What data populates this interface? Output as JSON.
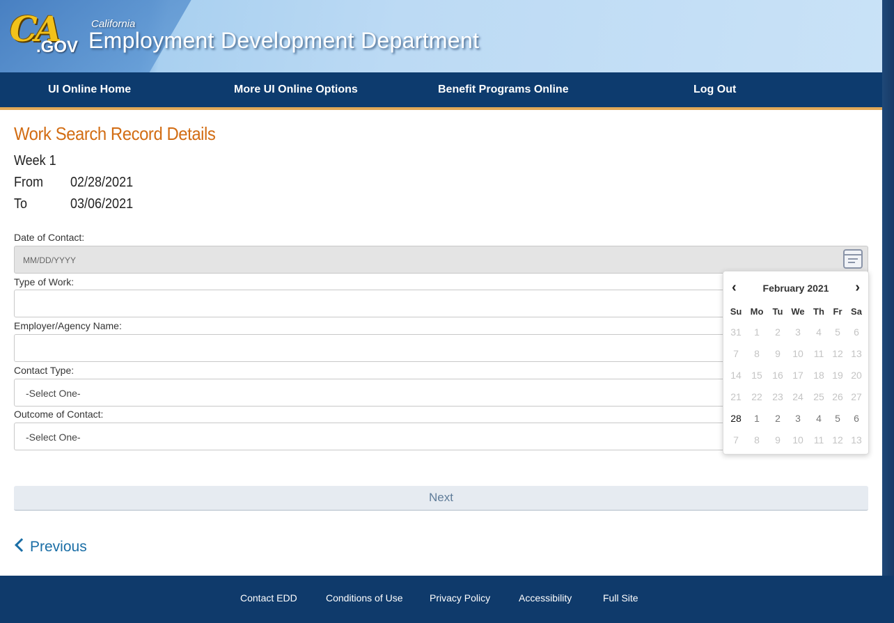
{
  "header": {
    "logo_ca": "CA",
    "logo_gov": ".GOV",
    "state": "California",
    "department": "Employment Development Department"
  },
  "nav": {
    "items": [
      "UI Online Home",
      "More UI Online Options",
      "Benefit Programs Online",
      "Log Out"
    ]
  },
  "page": {
    "title": "Work Search Record Details",
    "week": "Week 1",
    "from_label": "From",
    "from_value": "02/28/2021",
    "to_label": "To",
    "to_value": "03/06/2021"
  },
  "form": {
    "date_label": "Date of Contact:",
    "date_placeholder": "MM/DD/YYYY",
    "type_label": "Type of Work:",
    "type_value": "",
    "employer_label": "Employer/Agency Name:",
    "employer_value": "",
    "contact_type_label": "Contact Type:",
    "contact_type_value": "-Select One-",
    "outcome_label": "Outcome of Contact:",
    "outcome_value": "-Select One-",
    "next_label": "Next",
    "previous_label": "Previous"
  },
  "calendar": {
    "prev": "‹",
    "next": "›",
    "month": "February 2021",
    "days_of_week": [
      "Su",
      "Mo",
      "Tu",
      "We",
      "Th",
      "Fr",
      "Sa"
    ],
    "weeks": [
      [
        "31",
        "1",
        "2",
        "3",
        "4",
        "5",
        "6"
      ],
      [
        "7",
        "8",
        "9",
        "10",
        "11",
        "12",
        "13"
      ],
      [
        "14",
        "15",
        "16",
        "17",
        "18",
        "19",
        "20"
      ],
      [
        "21",
        "22",
        "23",
        "24",
        "25",
        "26",
        "27"
      ],
      [
        "28",
        "1",
        "2",
        "3",
        "4",
        "5",
        "6"
      ],
      [
        "7",
        "8",
        "9",
        "10",
        "11",
        "12",
        "13"
      ]
    ],
    "enabled_week_index": 4,
    "selected_day": "28"
  },
  "footer": {
    "links": [
      "Contact EDD",
      "Conditions of Use",
      "Privacy Policy",
      "Accessibility",
      "Full Site"
    ]
  },
  "colors": {
    "nav_bg": "#0d3b6e",
    "title": "#d26d14",
    "accent_stripe": "#e0a857",
    "link": "#1a6ea6"
  }
}
